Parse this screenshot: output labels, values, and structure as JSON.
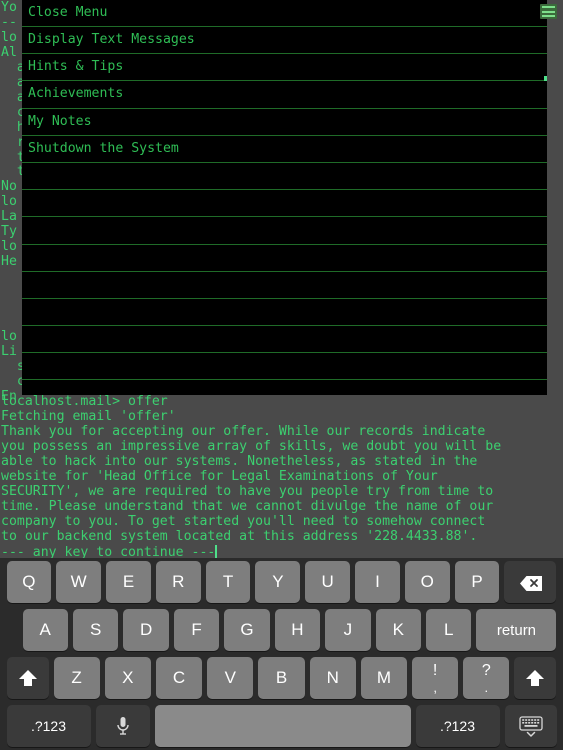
{
  "terminal": {
    "background_color": "#4a4a4a",
    "text_color": "#3cd070",
    "upper_lines": [
      "Yo",
      "--",
      "lo",
      "Al",
      "  a",
      "  a",
      "  a",
      "  c",
      "  h",
      "  r",
      "  t",
      "  t",
      "No",
      "lo",
      "La",
      "Ty",
      "lo",
      "He",
      "   (",
      "   (",
      "   |",
      "   |",
      "lo",
      "Li",
      "  s",
      "  c",
      "En"
    ],
    "lower_lines": [
      "localhost.mail> offer",
      "Fetching email 'offer'",
      "Thank you for accepting our offer. While our records indicate",
      "you possess an impressive array of skills, we doubt you will be",
      "able to hack into our systems. Nonetheless, as stated in the",
      "website for 'Head Office for Legal Examinations of Your",
      "SECURITY', we are required to have you people try from time to",
      "time. Please understand that we cannot divulge the name of our",
      "company to you. To get started you'll need to somehow connect",
      "to our backend system located at this address '228.4433.88'.",
      "--- any key to continue ---"
    ]
  },
  "menu": {
    "background_color": "#000000",
    "divider_color": "#1f6b28",
    "label_color": "#2fbd55",
    "items": [
      {
        "label": "Close Menu"
      },
      {
        "label": "Display Text Messages"
      },
      {
        "label": "Hints & Tips"
      },
      {
        "label": "Achievements"
      },
      {
        "label": "My Notes"
      },
      {
        "label": "Shutdown the System"
      },
      {
        "label": ""
      },
      {
        "label": ""
      },
      {
        "label": ""
      },
      {
        "label": ""
      },
      {
        "label": ""
      },
      {
        "label": ""
      },
      {
        "label": ""
      },
      {
        "label": ""
      }
    ]
  },
  "hamburger": {
    "icon": "hamburger-menu-icon",
    "color": "#7de08a"
  },
  "keyboard": {
    "background_color": "#2b2b2b",
    "key_color": "#7e7e7e",
    "key_dark_color": "#3a3a3a",
    "row1": [
      {
        "label": "Q"
      },
      {
        "label": "W"
      },
      {
        "label": "E"
      },
      {
        "label": "R"
      },
      {
        "label": "T"
      },
      {
        "label": "Y"
      },
      {
        "label": "U"
      },
      {
        "label": "I"
      },
      {
        "label": "O"
      },
      {
        "label": "P"
      }
    ],
    "backspace": {
      "icon": "backspace-icon",
      "label": ""
    },
    "row2": [
      {
        "label": "A"
      },
      {
        "label": "S"
      },
      {
        "label": "D"
      },
      {
        "label": "F"
      },
      {
        "label": "G"
      },
      {
        "label": "H"
      },
      {
        "label": "J"
      },
      {
        "label": "K"
      },
      {
        "label": "L"
      }
    ],
    "return": {
      "label": "return"
    },
    "row3": [
      {
        "label": "Z"
      },
      {
        "label": "X"
      },
      {
        "label": "C"
      },
      {
        "label": "V"
      },
      {
        "label": "B"
      },
      {
        "label": "N"
      },
      {
        "label": "M"
      }
    ],
    "row3_punct": [
      {
        "top": "!",
        "bottom": ","
      },
      {
        "top": "?",
        "bottom": "."
      }
    ],
    "shift_left": {
      "icon": "shift-arrow-icon",
      "label": ""
    },
    "shift_right": {
      "icon": "shift-arrow-icon",
      "label": ""
    },
    "numbers_left": {
      "label": ".?123"
    },
    "numbers_right": {
      "label": ".?123"
    },
    "mic": {
      "icon": "microphone-icon",
      "label": ""
    },
    "spacebar": {
      "label": ""
    },
    "dismiss": {
      "icon": "keyboard-dismiss-icon",
      "label": ""
    }
  }
}
